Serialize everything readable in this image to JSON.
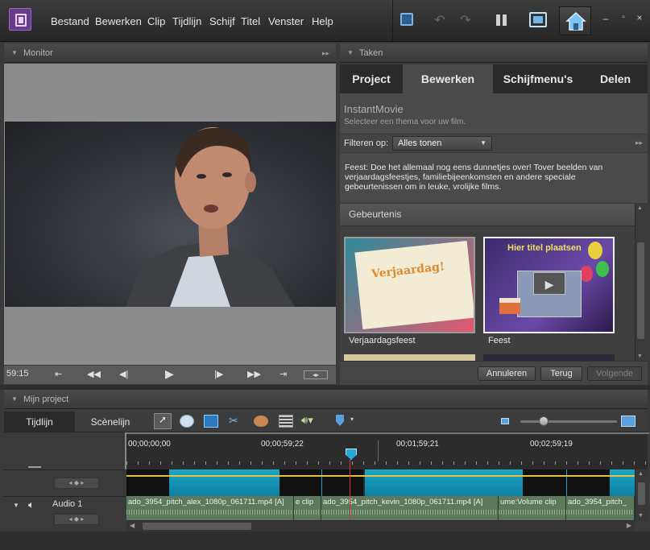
{
  "menubar": {
    "items": [
      "Bestand",
      "Bewerken",
      "Clip",
      "Tijdlijn",
      "Schijf",
      "Titel",
      "Venster",
      "Help"
    ]
  },
  "monitor": {
    "title": "Monitor",
    "timecode": "59:15"
  },
  "tasks": {
    "title": "Taken",
    "tabs": [
      "Project",
      "Bewerken",
      "Schijfmenu's",
      "Delen"
    ],
    "active_tab": "Bewerken",
    "instant_title": "InstantMovie",
    "instant_subtitle": "Selecteer een thema voor uw film.",
    "filter_label": "Filteren op:",
    "filter_value": "Alles tonen",
    "description": "Feest: Doe het allemaal nog eens dunnetjes over! Tover beelden van verjaardagsfeestjes, familiebijeenkomsten en andere speciale gebeurtenissen om in leuke, vrolijke films.",
    "category": "Gebeurtenis",
    "themes": [
      {
        "label": "Verjaardagsfeest",
        "thumb_text": "Verjaardag!"
      },
      {
        "label": "Feest",
        "thumb_text": "Hier titel plaatsen"
      }
    ],
    "buttons": {
      "cancel": "Annuleren",
      "back": "Terug",
      "next": "Volgende"
    }
  },
  "project": {
    "title": "Mijn project",
    "tabs": [
      "Tijdlijn",
      "Scènelijn"
    ],
    "active_tab": "Tijdlijn",
    "ruler_marks": [
      "00;00;00;00",
      "00;00;59;22",
      "00;01;59;21",
      "00;02;59;19"
    ],
    "audio_track_label": "Audio 1",
    "audio_clips": [
      "ado_3954_pitch_alex_1080p_061711.mp4 [A]",
      "e clip",
      "ado_3954_pitch_kevin_1080p_061711.mp4 [A]",
      "ume:Volume clip",
      "ado_3954_pitch_"
    ]
  },
  "colors": {
    "accent_cyan": "#1aa6c8",
    "playhead": "#e03030",
    "logo_purple": "#6a3a8c"
  }
}
